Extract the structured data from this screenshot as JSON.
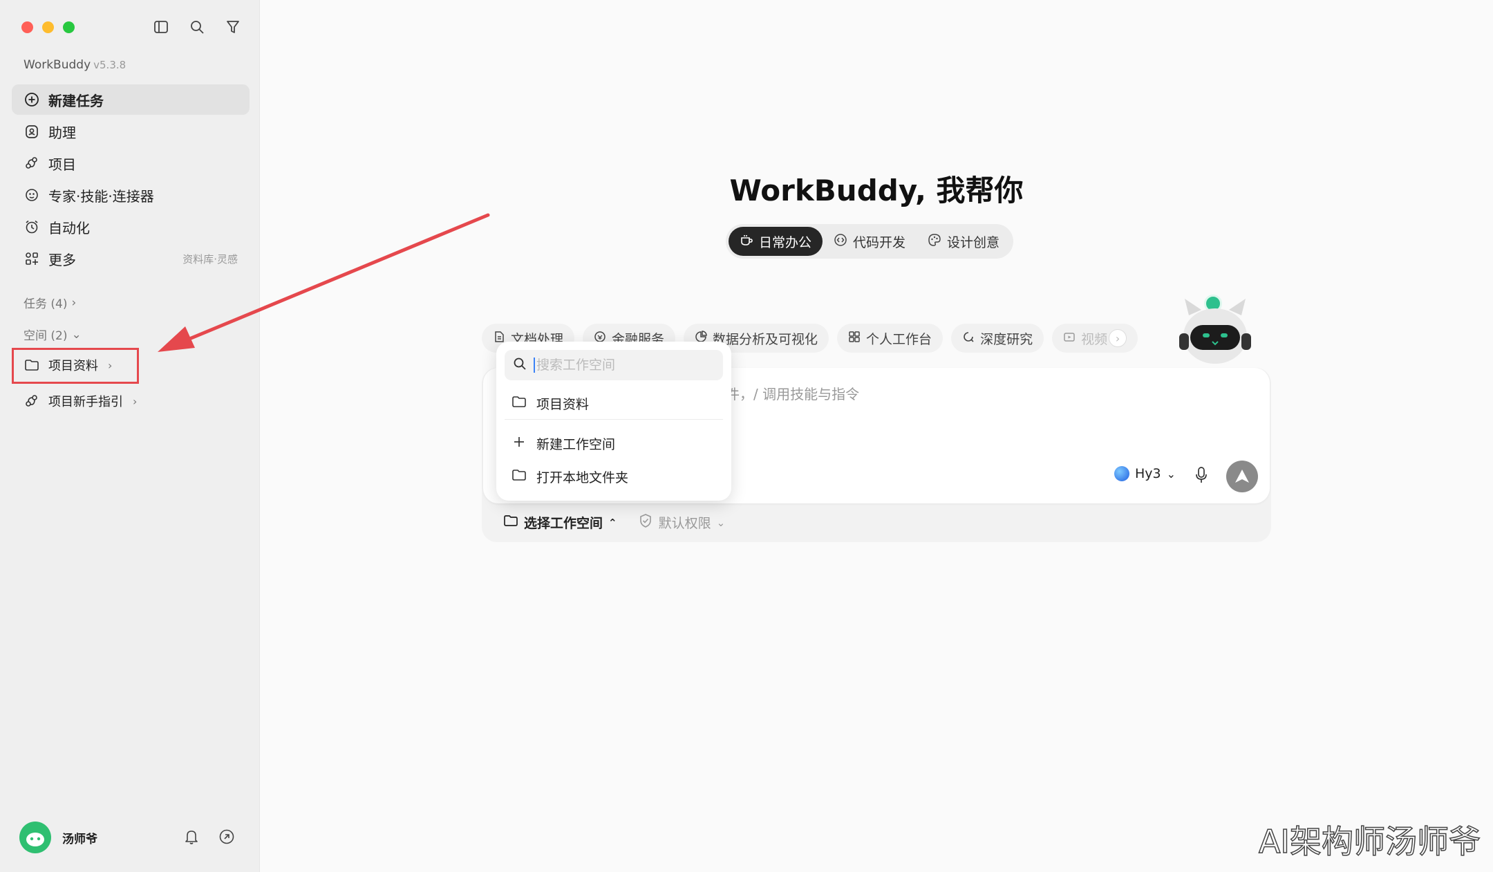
{
  "app": {
    "name": "WorkBuddy",
    "version": "v5.3.8"
  },
  "sidebar": {
    "nav": [
      {
        "label": "新建任务",
        "icon": "plus-circle-icon",
        "active": true
      },
      {
        "label": "助理",
        "icon": "assistant-icon"
      },
      {
        "label": "项目",
        "icon": "project-icon"
      },
      {
        "label": "专家·技能·连接器",
        "icon": "expert-icon"
      },
      {
        "label": "自动化",
        "icon": "alarm-icon"
      },
      {
        "label": "更多",
        "icon": "apps-icon",
        "hint": "资料库·灵感"
      }
    ],
    "tasks_label": "任务 (4)",
    "spaces_label": "空间 (2)",
    "workspaces": [
      {
        "label": "项目资料",
        "icon": "folder-icon"
      },
      {
        "label": "项目新手指引",
        "icon": "project-icon"
      }
    ],
    "user": {
      "name": "汤师爷"
    }
  },
  "main": {
    "headline": "WorkBuddy, 我帮你",
    "modes": [
      {
        "label": "日常办公",
        "icon": "cup-icon",
        "active": true
      },
      {
        "label": "代码开发",
        "icon": "code-icon"
      },
      {
        "label": "设计创意",
        "icon": "palette-icon"
      }
    ],
    "chips": [
      {
        "label": "文档处理",
        "icon": "document-icon"
      },
      {
        "label": "金融服务",
        "icon": "finance-icon"
      },
      {
        "label": "数据分析及可视化",
        "icon": "chart-icon"
      },
      {
        "label": "个人工作台",
        "icon": "grid-icon"
      },
      {
        "label": "深度研究",
        "icon": "research-icon"
      },
      {
        "label": "视频",
        "icon": "video-icon",
        "faded": true
      }
    ],
    "input": {
      "placeholder": "件，/ 调用技能与指令",
      "model": "Hy3"
    },
    "footer": {
      "workspace": "选择工作空间",
      "permission": "默认权限"
    }
  },
  "dropdown": {
    "search_placeholder": "搜索工作空间",
    "items": [
      {
        "label": "项目资料",
        "icon": "folder-icon"
      },
      {
        "label": "新建工作空间",
        "icon": "plus-icon"
      },
      {
        "label": "打开本地文件夹",
        "icon": "folder-icon"
      }
    ]
  },
  "watermark": "AI架构师汤师爷",
  "colors": {
    "annotation_red": "#e5484d",
    "accent_dark": "#262626",
    "badge_green": "#2dc08d"
  }
}
